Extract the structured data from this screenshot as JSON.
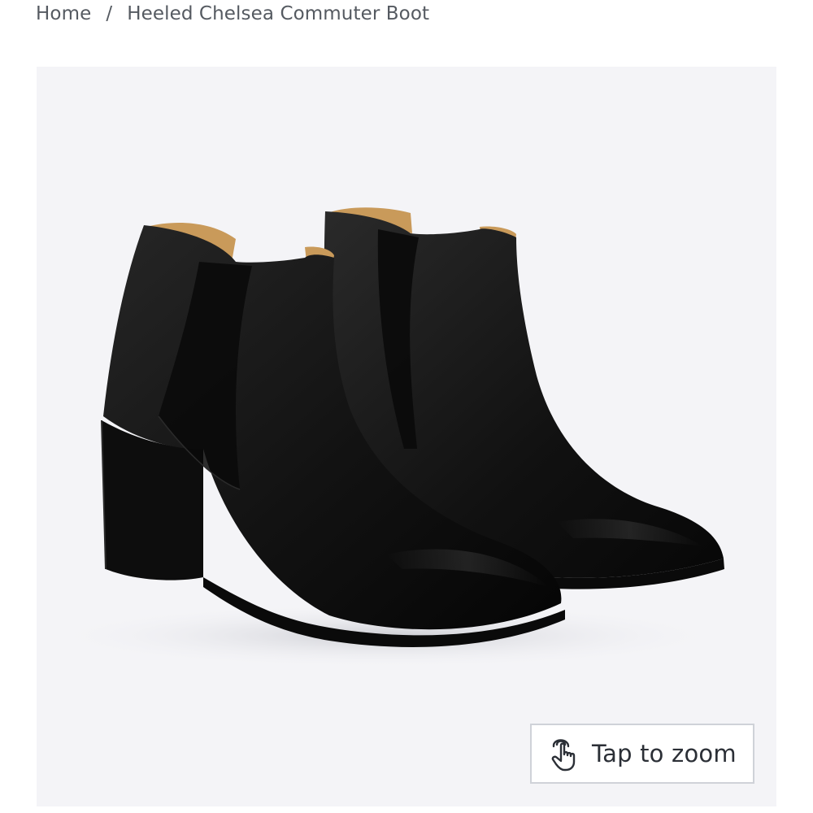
{
  "breadcrumb": {
    "home": "Home",
    "separator": "/",
    "current": "Heeled Chelsea Commuter Boot"
  },
  "product_image": {
    "alt": "Heeled Chelsea Commuter Boot",
    "background_color": "#f4f4f7",
    "boot_color": "#141414",
    "lining_color": "#c99a5a"
  },
  "zoom_button": {
    "label": "Tap to zoom",
    "icon": "tap-hand-icon"
  }
}
